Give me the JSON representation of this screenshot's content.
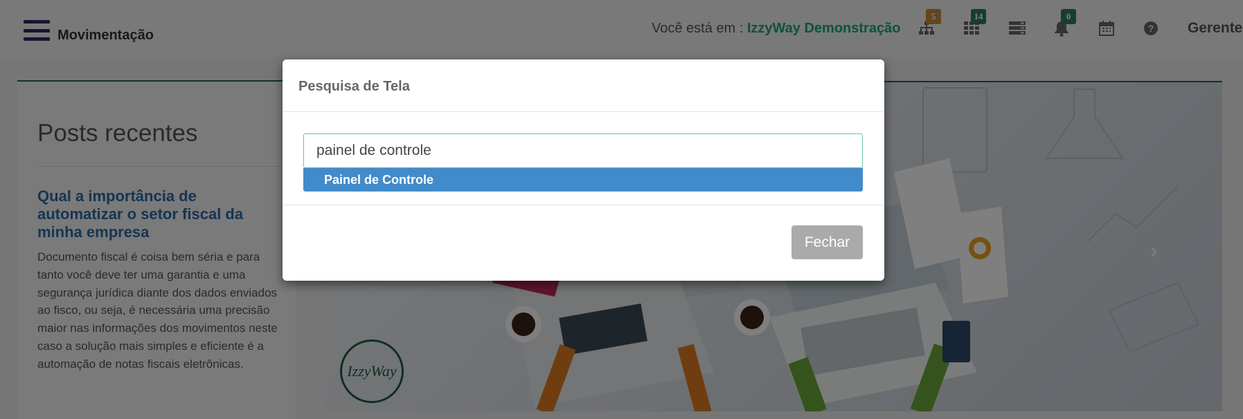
{
  "header": {
    "module_title": "Movimentação",
    "location_prefix": "Você está em : ",
    "company": "IzzyWay Demonstração",
    "user": "Gerente",
    "icons": [
      {
        "name": "sitemap-icon",
        "badge": "5",
        "badge_color": "#c98a3c"
      },
      {
        "name": "grid-icon",
        "badge": "14",
        "badge_color": "#2e7a66"
      },
      {
        "name": "server-icon",
        "badge": null
      },
      {
        "name": "bell-icon",
        "badge": "0",
        "badge_color": "#2e7a66"
      },
      {
        "name": "calendar-icon",
        "badge": null
      },
      {
        "name": "help-icon",
        "badge": null
      }
    ]
  },
  "posts": {
    "heading": "Posts recentes",
    "items": [
      {
        "title": "Qual a importância de automatizar o setor fiscal da minha empresa",
        "excerpt": "Documento fiscal é coisa bem séria e para tanto você deve ter uma garantia e uma segurança jurídica diante dos dados enviados ao fisco, ou seja, é necessária uma precisão maior nas informações dos movimentos neste caso a solução mais simples e eficiente é a automação de notas fiscais eletrônicas."
      }
    ]
  },
  "banner": {
    "logo_text": "IzzyWay"
  },
  "modal": {
    "title": "Pesquisa de Tela",
    "search_value": "painel de controle",
    "suggestions": [
      "Painel de Controle"
    ],
    "close_label": "Fechar"
  },
  "colors": {
    "brand_dark": "#2c2b66",
    "accent_green": "#1aa66b",
    "selection_blue": "#428bca"
  }
}
